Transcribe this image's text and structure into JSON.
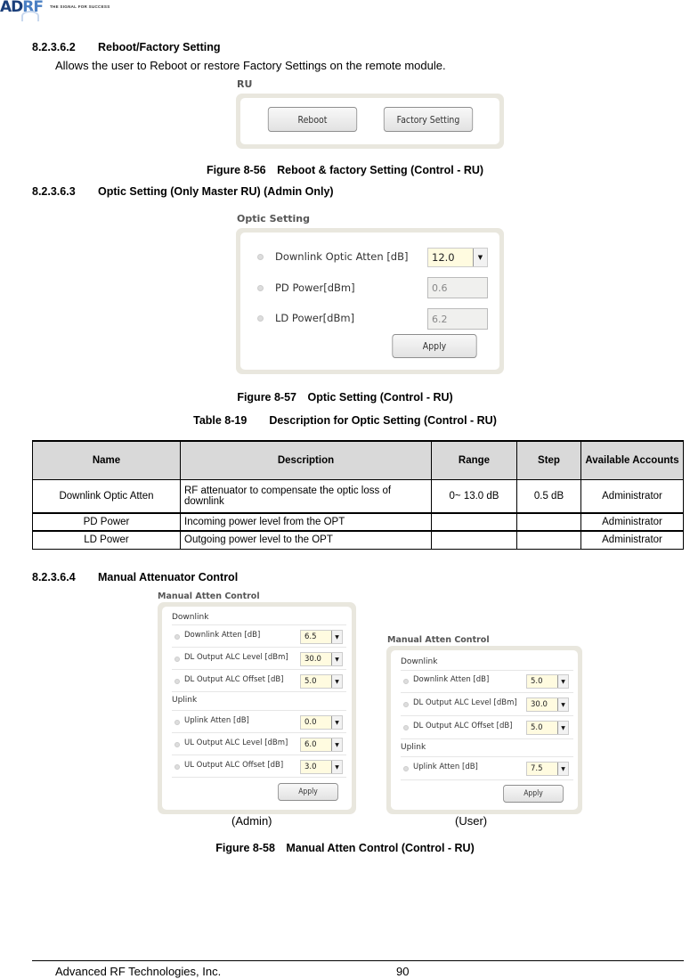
{
  "header": {
    "logo_text": "ADRF",
    "logo_tagline": "THE SIGNAL FOR SUCCESS"
  },
  "section_reboot": {
    "number": "8.2.3.6.2",
    "title": "Reboot/Factory Setting",
    "description": "Allows the user to Reboot or restore Factory Settings on the remote module.",
    "panel_title": "RU",
    "buttons": [
      "Reboot",
      "Factory Setting"
    ],
    "figure_caption": "Figure 8-56 Reboot & factory Setting (Control - RU)"
  },
  "section_optic": {
    "number": "8.2.3.6.3",
    "title": "Optic Setting (Only Master RU) (Admin Only)",
    "panel_title": "Optic Setting",
    "fields": [
      {
        "label": "Downlink Optic Atten [dB]",
        "value": "12.0",
        "type": "select"
      },
      {
        "label": "PD Power[dBm]",
        "value": "0.6",
        "type": "readonly"
      },
      {
        "label": "LD Power[dBm]",
        "value": "6.2",
        "type": "readonly"
      }
    ],
    "apply_label": "Apply",
    "figure_caption": "Figure 8-57 Optic Setting (Control - RU)"
  },
  "table": {
    "caption": "Table 8-19  Description for Optic Setting (Control - RU)",
    "headers": [
      "Name",
      "Description",
      "Range",
      "Step",
      "Available Accounts"
    ],
    "rows": [
      [
        "Downlink Optic Atten",
        "RF attenuator to compensate the optic loss of downlink",
        "0~ 13.0 dB",
        "0.5 dB",
        "Administrator"
      ],
      [
        "PD Power",
        "Incoming power level from the OPT",
        "",
        "",
        "Administrator"
      ],
      [
        "LD Power",
        "Outgoing power level to the OPT",
        "",
        "",
        "Administrator"
      ]
    ]
  },
  "section_manual": {
    "number": "8.2.3.6.4",
    "title": "Manual Attenuator Control",
    "admin_panel": {
      "title": "Manual Atten Control",
      "downlink_heading": "Downlink",
      "uplink_heading": "Uplink",
      "downlink": [
        {
          "label": "Downlink Atten [dB]",
          "value": "6.5"
        },
        {
          "label": "DL Output ALC Level [dBm]",
          "value": "30.0"
        },
        {
          "label": "DL Output ALC Offset [dB]",
          "value": "5.0"
        }
      ],
      "uplink": [
        {
          "label": "Uplink Atten [dB]",
          "value": "0.0"
        },
        {
          "label": "UL Output ALC Level [dBm]",
          "value": "6.0"
        },
        {
          "label": "UL Output ALC Offset [dB]",
          "value": "3.0"
        }
      ],
      "apply_label": "Apply",
      "sub_caption": "(Admin)"
    },
    "user_panel": {
      "title": "Manual Atten Control",
      "downlink_heading": "Downlink",
      "uplink_heading": "Uplink",
      "downlink": [
        {
          "label": "Downlink Atten [dB]",
          "value": "5.0"
        },
        {
          "label": "DL Output ALC Level [dBm]",
          "value": "30.0"
        },
        {
          "label": "DL Output ALC Offset [dB]",
          "value": "5.0"
        }
      ],
      "uplink": [
        {
          "label": "Uplink Atten [dB]",
          "value": "7.5"
        }
      ],
      "apply_label": "Apply",
      "sub_caption": "(User)"
    },
    "figure_caption": "Figure 8-58 Manual Atten Control (Control - RU)"
  },
  "footer": {
    "company": "Advanced RF Technologies, Inc.",
    "page_number": "90"
  }
}
